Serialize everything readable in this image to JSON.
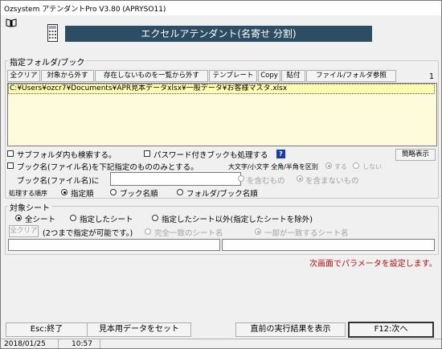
{
  "window": {
    "title": "Ozsystem アテンダントPro V3.80 (APRYSO11)"
  },
  "banner": {
    "title": "エクセルアテンダント(名寄せ 分割)"
  },
  "folder_group": {
    "legend": "指定フォルダ/ブック",
    "page_number": "1",
    "buttons": {
      "clear_all": "全クリア",
      "remove_from_list": "対象から外す",
      "remove_nonexistent": "存在しないものを一覧から外す",
      "template": "テンプレート",
      "copy": "Copy",
      "paste": "貼付",
      "browse": "ファイル/フォルダ参照"
    },
    "files": [
      "C:¥Users¥ozcr7¥Documents¥APR見本データxlsx¥一般データ¥お客様マスタ.xlsx"
    ]
  },
  "options": {
    "search_subfolders": "サブフォルダ内も検索する。",
    "process_password_books": "パスワード付きブックも処理する",
    "help_mark": "?",
    "simple_view": "簡略表示",
    "book_name_filter": "ブック名(ファイル名)を下記指定のもののみとする。",
    "case_width_label": "大文字/小文字 全角/半角を区別",
    "case_yes": "する",
    "case_no": "しない",
    "book_name_in_label": "ブック名(ファイル名)に",
    "book_name_value": "",
    "contains": "を含むもの",
    "not_contains": "を含まないもの",
    "order_label": "処理する順序",
    "order_specified": "指定順",
    "order_book": "ブック名順",
    "order_folder_book": "フォルダ/ブック名順"
  },
  "sheet_group": {
    "legend": "対象シート",
    "all_sheets": "全シート",
    "specified_sheets": "指定したシート",
    "except_specified": "指定したシート以外(指定したシートを除外)",
    "clear_all": "全クリア",
    "two_or_more_note": "(2つまで指定が可能です。)",
    "exact_match": "完全一致のシート名",
    "partial_match": "一部が一致するシート名",
    "sheet_name_1": "",
    "sheet_name_2": ""
  },
  "notice": "次画面でパラメータを設定します。",
  "footer_buttons": {
    "exit": "Esc:終了",
    "sample_data": "見本用データをセット",
    "show_last_result": "直前の実行結果を表示",
    "next": "F12:次へ"
  },
  "status_bar": {
    "date": "2018/01/25",
    "time": "10:57"
  },
  "icons": {
    "book": "book-icon",
    "calculator": "calculator-icon"
  },
  "colors": {
    "banner_bg": "#2d4d64",
    "list_bg": "#fdfbdc",
    "notice_text": "#b01010"
  }
}
